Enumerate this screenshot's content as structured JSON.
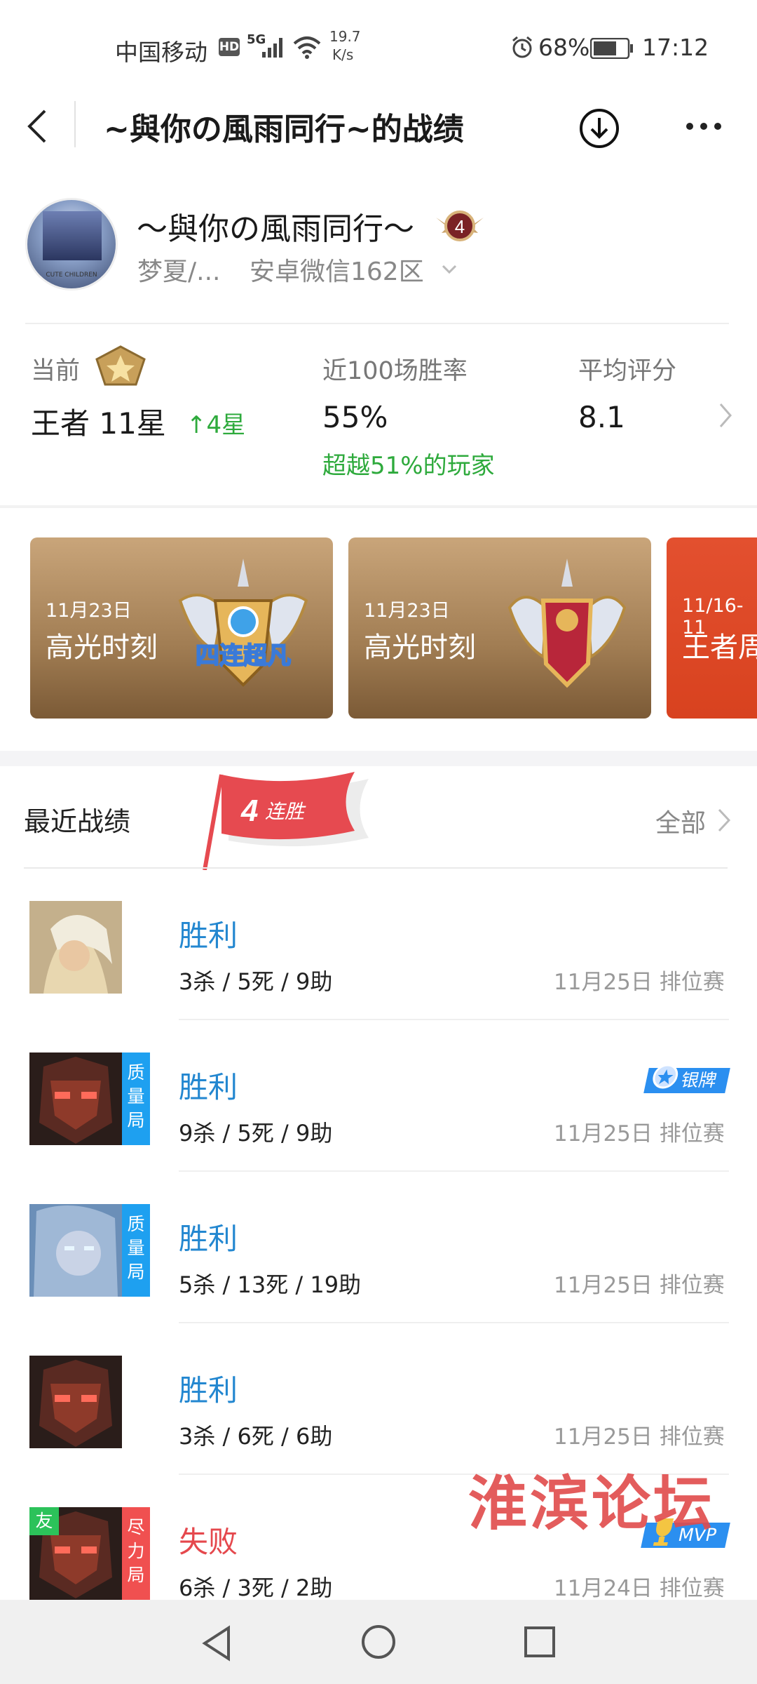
{
  "status_bar": {
    "carrier": "中国移动",
    "hd": "HD",
    "network": "5G",
    "speed_value": "19.7",
    "speed_unit": "K/s",
    "battery": "68%",
    "time": "17:12"
  },
  "nav": {
    "title": "~與你の風雨同行~的战绩"
  },
  "profile": {
    "name": "〜與你の風雨同行〜",
    "rank_level": "4",
    "subtitle_short": "梦夏/...",
    "server": "安卓微信162区",
    "avatar_caption": "CUTE CHILDREN"
  },
  "stats": {
    "current_label": "当前",
    "current_value": "王者 11星",
    "current_delta": "↑4星",
    "winrate_label": "近100场胜率",
    "winrate_value": "55%",
    "winrate_note": "超越51%的玩家",
    "score_label": "平均评分",
    "score_value": "8.1"
  },
  "highlights": [
    {
      "date": "11月23日",
      "title": "高光时刻",
      "emblem_text": "四连超凡"
    },
    {
      "date": "11月23日",
      "title": "高光时刻"
    },
    {
      "date": "11/16-11",
      "title": "王者周"
    }
  ],
  "recent": {
    "title": "最近战绩",
    "streak_number": "4",
    "streak_text": "连胜",
    "all_label": "全部"
  },
  "matches": [
    {
      "result": "胜利",
      "kda": "3杀 / 5死 / 9助",
      "meta": "11月25日 排位赛",
      "tag": "",
      "badge": ""
    },
    {
      "result": "胜利",
      "kda": "9杀 / 5死 / 9助",
      "meta": "11月25日 排位赛",
      "tag": "质量局",
      "badge": "银牌"
    },
    {
      "result": "胜利",
      "kda": "5杀 / 13死 / 19助",
      "meta": "11月25日 排位赛",
      "tag": "质量局",
      "badge": ""
    },
    {
      "result": "胜利",
      "kda": "3杀 / 6死 / 6助",
      "meta": "11月25日 排位赛",
      "tag": "",
      "badge": ""
    },
    {
      "result": "失败",
      "kda": "6杀 / 3死 / 2助",
      "meta": "11月24日 排位赛",
      "tag": "尽力局",
      "friend": "友",
      "badge": "MVP"
    }
  ],
  "watermark": "淮滨论坛",
  "colors": {
    "win": "#2387d0",
    "lose": "#e5484d",
    "green": "#2eaa3c",
    "quality_tag": "#1ea0f0",
    "effort_tag": "#f05050",
    "friend_tag": "#2cc25a"
  }
}
